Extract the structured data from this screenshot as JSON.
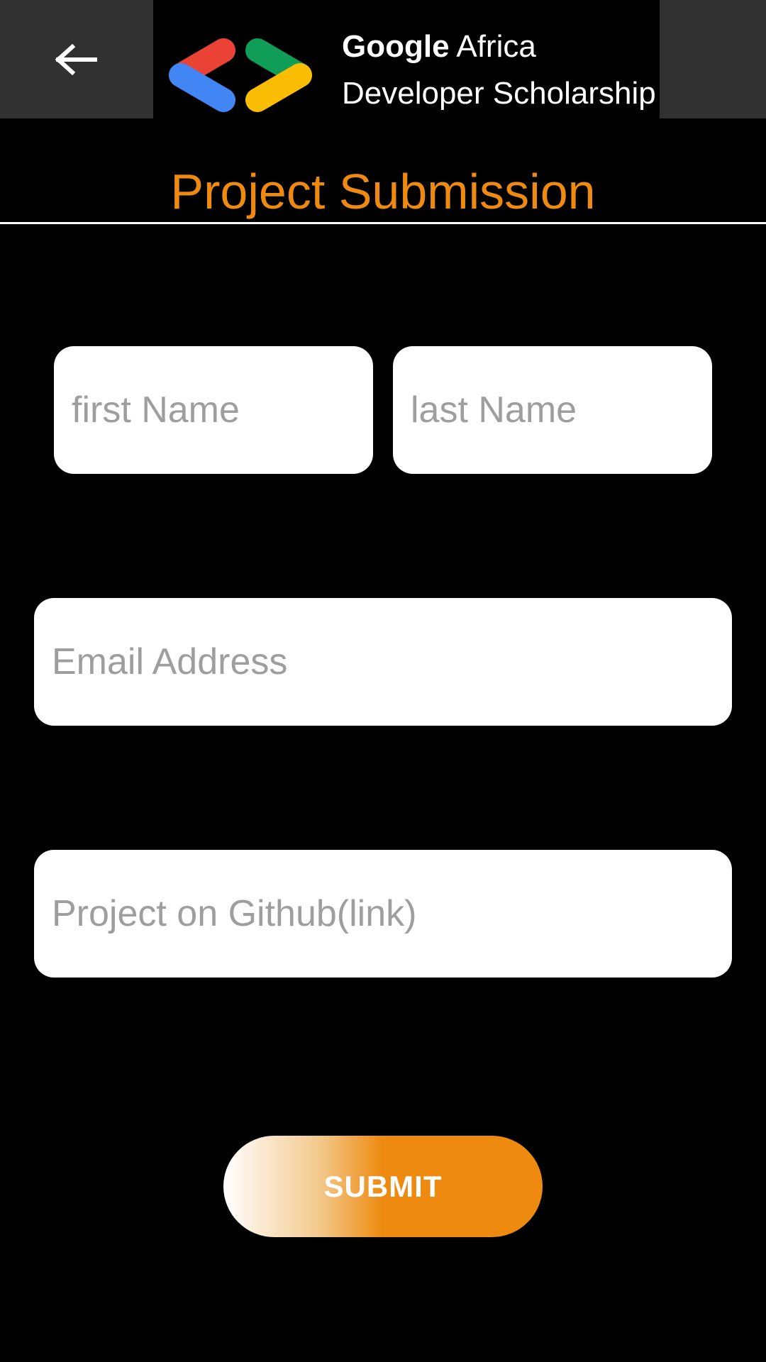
{
  "toolbar": {
    "back_icon": "arrow-left-icon",
    "logo_icon": "google-developers-logo-icon",
    "brand_google": "Google",
    "brand_africa": "Africa",
    "brand_line2": "Developer Scholarship",
    "colors": {
      "background": "#000000",
      "side_panel": "#313131",
      "logo_red": "#EA4335",
      "logo_blue": "#4285F4",
      "logo_green": "#0F9D58",
      "logo_yellow": "#FBBC04"
    }
  },
  "page": {
    "title": "Project Submission",
    "title_color": "#EE8A0F"
  },
  "form": {
    "first_name": {
      "value": "",
      "placeholder": "first Name"
    },
    "last_name": {
      "value": "",
      "placeholder": "last Name"
    },
    "email": {
      "value": "",
      "placeholder": "Email Address"
    },
    "github": {
      "value": "",
      "placeholder": "Project on Github(link)"
    },
    "submit_label": "SUBMIT",
    "accent_color": "#EE8A0F"
  }
}
